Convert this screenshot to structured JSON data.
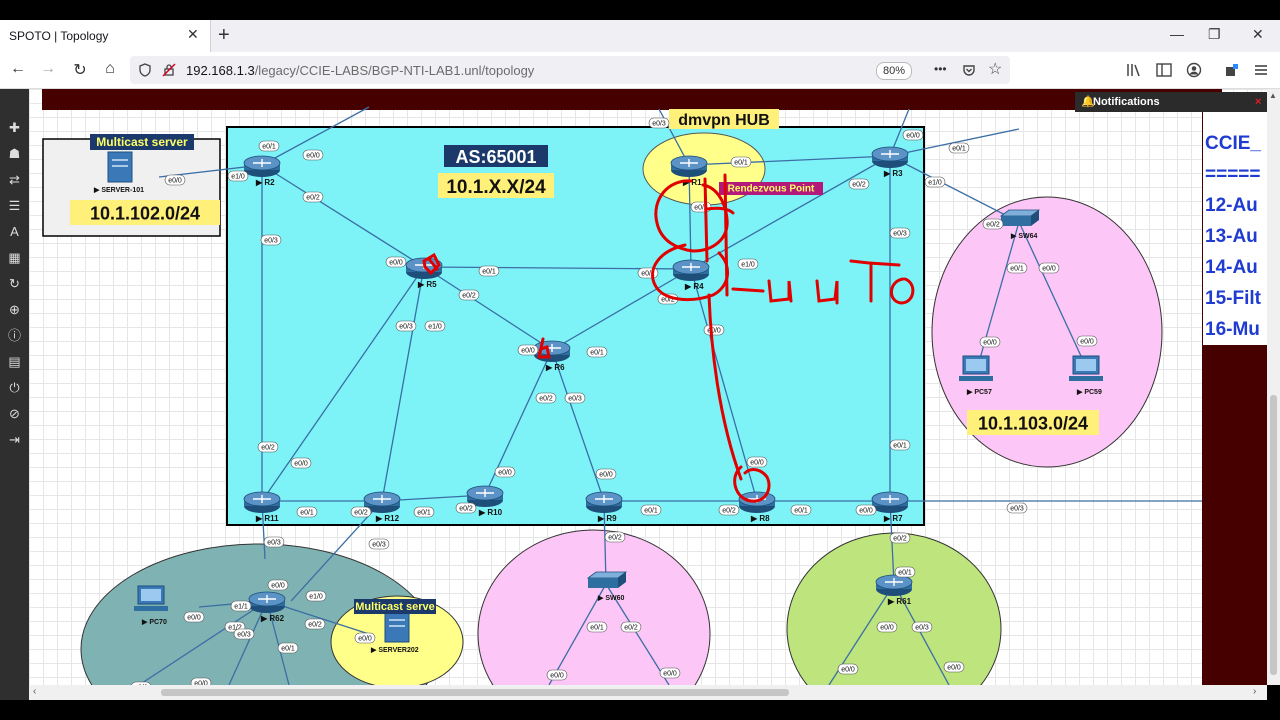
{
  "browser": {
    "tab_title": "SPOTO | Topology",
    "tab_close": "✕",
    "new_tab": "+",
    "win_min": "—",
    "win_max": "❐",
    "win_close": "✕",
    "url_host": "192.168.1.3",
    "url_path": "/legacy/CCIE-LABS/BGP-NTI-LAB1.unl/topology",
    "zoom": "80%",
    "nav_back": "←",
    "nav_forward": "→",
    "nav_reload": "↻",
    "nav_home": "⌂",
    "more": "•••"
  },
  "notifications": {
    "label": "Notifications",
    "close": "×"
  },
  "ccie_panel": [
    "CCIE_",
    "=====",
    "12-Au",
    "13-Au",
    "14-Au",
    "15-Filt",
    "16-Mu"
  ],
  "topology": {
    "as_label": "AS:65001",
    "as_subnet": "10.1.X.X/24",
    "hub_label": "dmvpn HUB",
    "rp_label": "Rendezvous Point",
    "multicast_box1": {
      "title": "Multicast server",
      "subnet": "10.1.102.0/24",
      "server": "SERVER-101"
    },
    "multicast_box2": {
      "title": "Multicast serve",
      "server": "SERVER202"
    },
    "subnet_103": "10.1.103.0/24",
    "nodes": {
      "R1": "R1",
      "R2": "R2",
      "R3": "R3",
      "R4": "R4",
      "R5": "R5",
      "R6": "R6",
      "R7": "R7",
      "R8": "R8",
      "R9": "R9",
      "R10": "R10",
      "R11": "R11",
      "R12": "R12",
      "R61": "R61",
      "R62": "R62",
      "SW60": "SW60",
      "SW64": "SW64",
      "PC57": "PC57",
      "PC59": "PC59",
      "PC70": "PC70"
    },
    "handwriting": "auto",
    "ports": {
      "p_r2_e01": "e0/1",
      "p_r2_e00": "e0/0",
      "p_r2_e10": "e1/0",
      "p_r2_e02": "e0/2",
      "p_r2_e03": "e0/3",
      "p_srv_e00": "e0/0",
      "p_r1_e03": "e0/3",
      "p_r1_e01": "e0/1",
      "p_r1_e02": "e0/2",
      "p_r3_e00": "e0/0",
      "p_r3_e01": "e0/1",
      "p_r3_e02": "e0/2",
      "p_r3_e10": "e1/0",
      "p_r3_e03": "e0/3",
      "p_r5_e00": "e0/0",
      "p_r5_e01": "e0/1",
      "p_r5_e02": "e0/2",
      "p_r5_e03": "e0/3",
      "p_r5_e10": "e1/0",
      "p_r4_e01": "e0/1",
      "p_r4_e10": "e1/0",
      "p_r4_e02": "e0/2",
      "p_r4_e00": "e0/0",
      "p_r6_e00": "e0/0",
      "p_r6_e01": "e0/1",
      "p_r6_e02": "e0/2",
      "p_r6_e03": "e0/3",
      "p_sw64_e02": "e0/2",
      "p_sw64_e01": "e0/1",
      "p_sw64_e00": "e0/0",
      "p_pc57_e00": "e0/0",
      "p_pc59_e00": "e0/0",
      "p_r11_e02": "e0/2",
      "p_r11_e01": "e0/1",
      "p_r11_e03": "e0/3",
      "p_r12_e00": "e0/0",
      "p_r12_e02": "e0/2",
      "p_r12_e01": "e0/1",
      "p_r12_e03": "e0/3",
      "p_r11b_e00": "e0/0",
      "p_r10_e00": "e0/0",
      "p_r10_e02": "e0/2",
      "p_r9_e00": "e0/0",
      "p_r9_e01": "e0/1",
      "p_r9_e02": "e0/2",
      "p_r8_e00": "e0/0",
      "p_r8_e02": "e0/2",
      "p_r8_e01": "e0/1",
      "p_r7_e00": "e0/0",
      "p_r7_e01": "e0/1",
      "p_r7_e03": "e0/3",
      "p_r7_e02": "e0/2",
      "p_r62_e00": "e0/0",
      "p_r62_e10": "e1/0",
      "p_r62_e11": "e1/1",
      "p_r62_e12": "e1/2",
      "p_r62_e02": "e0/2",
      "p_r62_e03": "e0/3",
      "p_r62_e01": "e0/1",
      "p_pc70_e00": "e0/0",
      "p_srv202_e00": "e0/0",
      "p_sw60_e01": "e0/1",
      "p_sw60_e02": "e0/2",
      "p_sw60_e00a": "e0/0",
      "p_sw60_e00b": "e0/0",
      "p_r61_e01": "e0/1",
      "p_r61_e00": "e0/0",
      "p_r61_e03": "e0/3",
      "p_r61_e00b": "e0/0",
      "p_r61_e00c": "e0/0",
      "p_r62_e00b": "e0/0",
      "p_r62_e00c": "e0/0"
    }
  },
  "colors": {
    "as_box": "#7ef3f7",
    "hub_ellipse": "#ffff8a",
    "pink_ellipse": "#fcc6f6",
    "teal_ellipse": "#7fb3b3",
    "green_ellipse": "#bde47d",
    "label_yellow": "#fff07a",
    "title_navy": "#1b3a6b",
    "handwriting_red": "#e00000",
    "dark_band": "#470000"
  }
}
